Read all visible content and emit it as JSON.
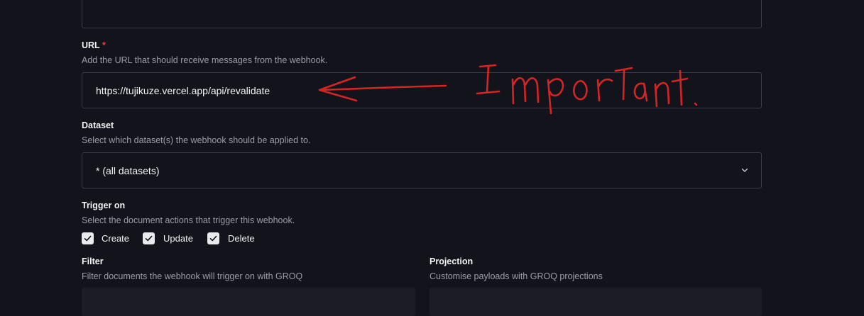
{
  "url_field": {
    "label": "URL",
    "required_marker": "*",
    "description": "Add the URL that should receive messages from the webhook.",
    "value": "https://tujikuze.vercel.app/api/revalidate"
  },
  "dataset_field": {
    "label": "Dataset",
    "description": "Select which dataset(s) the webhook should be applied to.",
    "selected": "* (all datasets)"
  },
  "trigger_field": {
    "label": "Trigger on",
    "description": "Select the document actions that trigger this webhook.",
    "options": [
      {
        "label": "Create",
        "checked": true
      },
      {
        "label": "Update",
        "checked": true
      },
      {
        "label": "Delete",
        "checked": true
      }
    ]
  },
  "filter_field": {
    "label": "Filter",
    "description": "Filter documents the webhook will trigger on with GROQ"
  },
  "projection_field": {
    "label": "Projection",
    "description": "Customise payloads with GROQ projections"
  },
  "annotation": {
    "text": "Important.",
    "color": "#d42424"
  },
  "icons": {
    "dropdown": "chevron-down-icon",
    "checkbox": "check-icon"
  }
}
